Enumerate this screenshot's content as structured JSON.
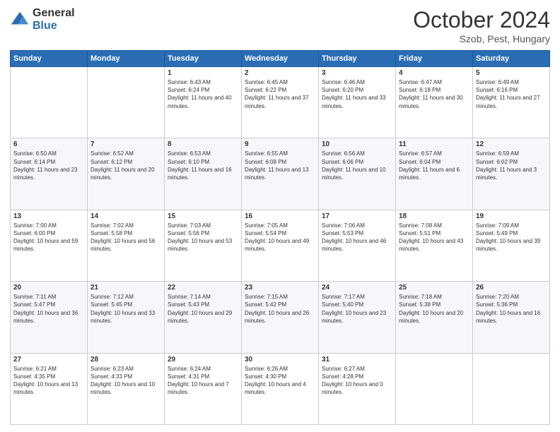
{
  "header": {
    "logo_general": "General",
    "logo_blue": "Blue",
    "title": "October 2024",
    "location": "Szob, Pest, Hungary"
  },
  "days_of_week": [
    "Sunday",
    "Monday",
    "Tuesday",
    "Wednesday",
    "Thursday",
    "Friday",
    "Saturday"
  ],
  "weeks": [
    [
      {
        "day": "",
        "info": ""
      },
      {
        "day": "",
        "info": ""
      },
      {
        "day": "1",
        "info": "Sunrise: 6:43 AM\nSunset: 6:24 PM\nDaylight: 11 hours and 40 minutes."
      },
      {
        "day": "2",
        "info": "Sunrise: 6:45 AM\nSunset: 6:22 PM\nDaylight: 11 hours and 37 minutes."
      },
      {
        "day": "3",
        "info": "Sunrise: 6:46 AM\nSunset: 6:20 PM\nDaylight: 11 hours and 33 minutes."
      },
      {
        "day": "4",
        "info": "Sunrise: 6:47 AM\nSunset: 6:18 PM\nDaylight: 11 hours and 30 minutes."
      },
      {
        "day": "5",
        "info": "Sunrise: 6:49 AM\nSunset: 6:16 PM\nDaylight: 11 hours and 27 minutes."
      }
    ],
    [
      {
        "day": "6",
        "info": "Sunrise: 6:50 AM\nSunset: 6:14 PM\nDaylight: 11 hours and 23 minutes."
      },
      {
        "day": "7",
        "info": "Sunrise: 6:52 AM\nSunset: 6:12 PM\nDaylight: 11 hours and 20 minutes."
      },
      {
        "day": "8",
        "info": "Sunrise: 6:53 AM\nSunset: 6:10 PM\nDaylight: 11 hours and 16 minutes."
      },
      {
        "day": "9",
        "info": "Sunrise: 6:55 AM\nSunset: 6:08 PM\nDaylight: 11 hours and 13 minutes."
      },
      {
        "day": "10",
        "info": "Sunrise: 6:56 AM\nSunset: 6:06 PM\nDaylight: 11 hours and 10 minutes."
      },
      {
        "day": "11",
        "info": "Sunrise: 6:57 AM\nSunset: 6:04 PM\nDaylight: 11 hours and 6 minutes."
      },
      {
        "day": "12",
        "info": "Sunrise: 6:59 AM\nSunset: 6:02 PM\nDaylight: 11 hours and 3 minutes."
      }
    ],
    [
      {
        "day": "13",
        "info": "Sunrise: 7:00 AM\nSunset: 6:00 PM\nDaylight: 10 hours and 59 minutes."
      },
      {
        "day": "14",
        "info": "Sunrise: 7:02 AM\nSunset: 5:58 PM\nDaylight: 10 hours and 56 minutes."
      },
      {
        "day": "15",
        "info": "Sunrise: 7:03 AM\nSunset: 5:56 PM\nDaylight: 10 hours and 53 minutes."
      },
      {
        "day": "16",
        "info": "Sunrise: 7:05 AM\nSunset: 5:54 PM\nDaylight: 10 hours and 49 minutes."
      },
      {
        "day": "17",
        "info": "Sunrise: 7:06 AM\nSunset: 5:53 PM\nDaylight: 10 hours and 46 minutes."
      },
      {
        "day": "18",
        "info": "Sunrise: 7:08 AM\nSunset: 5:51 PM\nDaylight: 10 hours and 43 minutes."
      },
      {
        "day": "19",
        "info": "Sunrise: 7:09 AM\nSunset: 5:49 PM\nDaylight: 10 hours and 39 minutes."
      }
    ],
    [
      {
        "day": "20",
        "info": "Sunrise: 7:11 AM\nSunset: 5:47 PM\nDaylight: 10 hours and 36 minutes."
      },
      {
        "day": "21",
        "info": "Sunrise: 7:12 AM\nSunset: 5:45 PM\nDaylight: 10 hours and 33 minutes."
      },
      {
        "day": "22",
        "info": "Sunrise: 7:14 AM\nSunset: 5:43 PM\nDaylight: 10 hours and 29 minutes."
      },
      {
        "day": "23",
        "info": "Sunrise: 7:15 AM\nSunset: 5:42 PM\nDaylight: 10 hours and 26 minutes."
      },
      {
        "day": "24",
        "info": "Sunrise: 7:17 AM\nSunset: 5:40 PM\nDaylight: 10 hours and 23 minutes."
      },
      {
        "day": "25",
        "info": "Sunrise: 7:18 AM\nSunset: 5:38 PM\nDaylight: 10 hours and 20 minutes."
      },
      {
        "day": "26",
        "info": "Sunrise: 7:20 AM\nSunset: 5:36 PM\nDaylight: 10 hours and 16 minutes."
      }
    ],
    [
      {
        "day": "27",
        "info": "Sunrise: 6:21 AM\nSunset: 4:35 PM\nDaylight: 10 hours and 13 minutes."
      },
      {
        "day": "28",
        "info": "Sunrise: 6:23 AM\nSunset: 4:33 PM\nDaylight: 10 hours and 10 minutes."
      },
      {
        "day": "29",
        "info": "Sunrise: 6:24 AM\nSunset: 4:31 PM\nDaylight: 10 hours and 7 minutes."
      },
      {
        "day": "30",
        "info": "Sunrise: 6:26 AM\nSunset: 4:30 PM\nDaylight: 10 hours and 4 minutes."
      },
      {
        "day": "31",
        "info": "Sunrise: 6:27 AM\nSunset: 4:28 PM\nDaylight: 10 hours and 0 minutes."
      },
      {
        "day": "",
        "info": ""
      },
      {
        "day": "",
        "info": ""
      }
    ]
  ]
}
